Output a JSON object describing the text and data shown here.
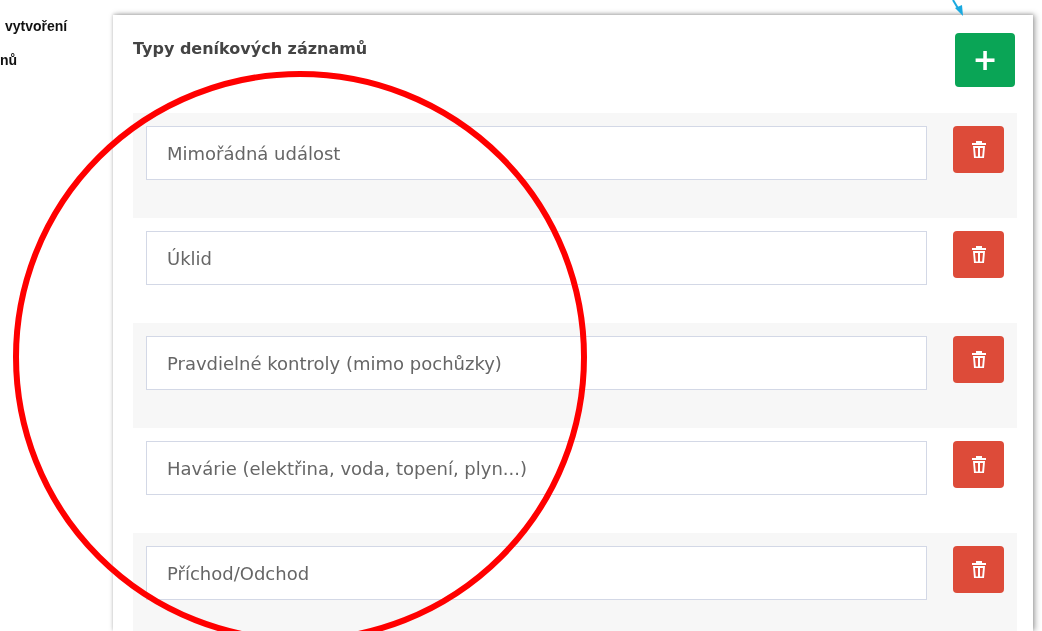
{
  "caption_lines": [
    "vytvoření",
    "nů"
  ],
  "panel": {
    "title": "Typy deníkových záznamů",
    "add_button": "+"
  },
  "entries": [
    {
      "value": "Mimořádná událost"
    },
    {
      "value": "Úklid"
    },
    {
      "value": "Pravdielné kontroly (mimo pochůzky)"
    },
    {
      "value": "Havárie (elektřina, voda, topení, plyn...)"
    },
    {
      "value": "Příchod/Odchod"
    }
  ]
}
